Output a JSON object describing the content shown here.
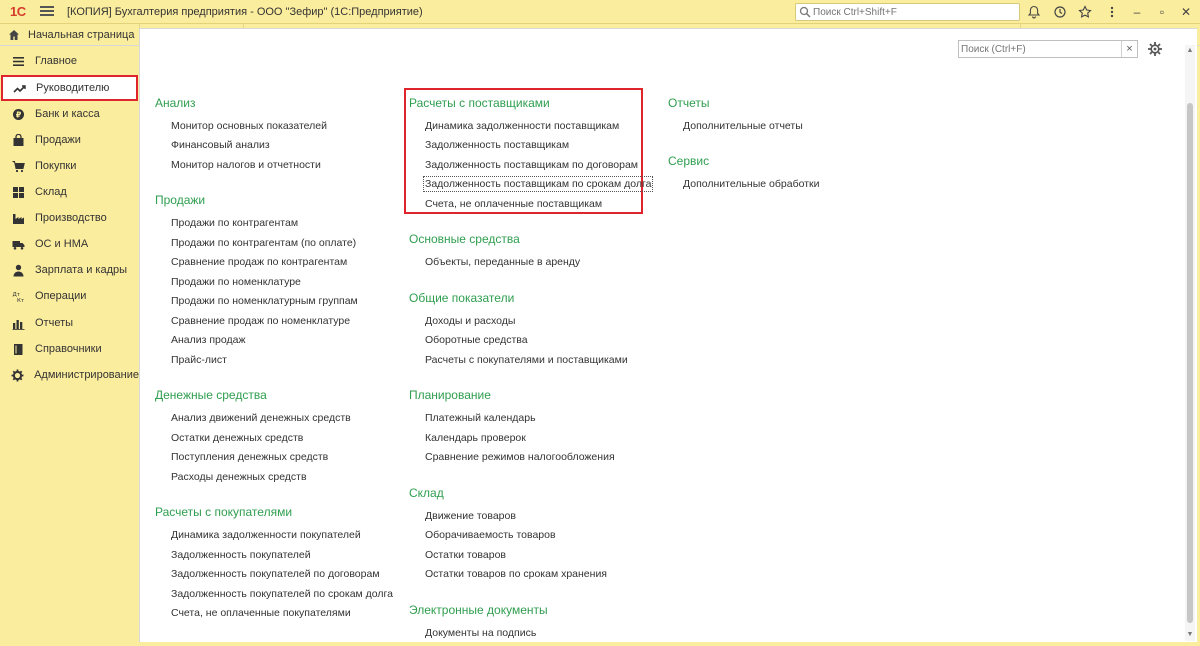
{
  "titlebar": {
    "logo": "1С",
    "title": "[КОПИЯ] Бухгалтерия предприятия - ООО \"Зефир\"  (1С:Предприятие)",
    "search_placeholder": "Поиск Ctrl+Shift+F",
    "icons": [
      "bell-icon",
      "history-icon",
      "star-icon",
      "more-icon"
    ],
    "window_buttons": {
      "minimize": "–",
      "restore": "▫",
      "close": "✕"
    }
  },
  "tabs": {
    "home_label": "Начальная страница"
  },
  "sidebar": {
    "items": [
      {
        "label": "Главное",
        "icon": "list-icon"
      },
      {
        "label": "Руководителю",
        "icon": "trend-icon"
      },
      {
        "label": "Банк и касса",
        "icon": "coin-icon"
      },
      {
        "label": "Продажи",
        "icon": "bag-icon"
      },
      {
        "label": "Покупки",
        "icon": "cart-icon"
      },
      {
        "label": "Склад",
        "icon": "warehouse-icon"
      },
      {
        "label": "Производство",
        "icon": "factory-icon"
      },
      {
        "label": "ОС и НМА",
        "icon": "truck-icon"
      },
      {
        "label": "Зарплата и кадры",
        "icon": "person-icon"
      },
      {
        "label": "Операции",
        "icon": "operations-icon"
      },
      {
        "label": "Отчеты",
        "icon": "bar-chart-icon"
      },
      {
        "label": "Справочники",
        "icon": "book-icon"
      },
      {
        "label": "Администрирование",
        "icon": "gear-icon"
      }
    ],
    "active_index": 1
  },
  "panel": {
    "search_placeholder": "Поиск (Ctrl+F)",
    "clear": "×"
  },
  "columns": {
    "col1": [
      {
        "title": "Анализ",
        "links": [
          "Монитор основных показателей",
          "Финансовый анализ",
          "Монитор налогов и отчетности"
        ]
      },
      {
        "title": "Продажи",
        "links": [
          "Продажи по контрагентам",
          "Продажи по контрагентам (по оплате)",
          "Сравнение продаж по контрагентам",
          "Продажи по номенклатуре",
          "Продажи по номенклатурным группам",
          "Сравнение продаж по номенклатуре",
          "Анализ продаж",
          "Прайс-лист"
        ]
      },
      {
        "title": "Денежные средства",
        "links": [
          "Анализ движений денежных средств",
          "Остатки денежных средств",
          "Поступления денежных средств",
          "Расходы денежных средств"
        ]
      },
      {
        "title": "Расчеты с покупателями",
        "links": [
          "Динамика задолженности покупателей",
          "Задолженность покупателей",
          "Задолженность покупателей по договорам",
          "Задолженность покупателей по срокам долга",
          "Счета, не оплаченные покупателями"
        ]
      }
    ],
    "col2": [
      {
        "title": "Расчеты с поставщиками",
        "links": [
          "Динамика задолженности поставщикам",
          "Задолженность поставщикам",
          "Задолженность поставщикам по договорам",
          "Задолженность поставщикам по срокам долга",
          "Счета, не оплаченные поставщикам"
        ]
      },
      {
        "title": "Основные средства",
        "links": [
          "Объекты, переданные в аренду"
        ]
      },
      {
        "title": "Общие показатели",
        "links": [
          "Доходы и расходы",
          "Оборотные средства",
          "Расчеты с покупателями и поставщиками"
        ]
      },
      {
        "title": "Планирование",
        "links": [
          "Платежный календарь",
          "Календарь проверок",
          "Сравнение режимов налогообложения"
        ]
      },
      {
        "title": "Склад",
        "links": [
          "Движение товаров",
          "Оборачиваемость товаров",
          "Остатки товаров",
          "Остатки товаров по срокам хранения"
        ]
      },
      {
        "title": "Электронные документы",
        "links": [
          "Документы на подпись"
        ]
      }
    ],
    "col3": [
      {
        "title": "Отчеты",
        "links": [
          "Дополнительные отчеты"
        ]
      },
      {
        "title": "Сервис",
        "links": [
          "Дополнительные обработки"
        ]
      }
    ]
  },
  "colors": {
    "background": "#fbed9e",
    "section_title": "#2f9e4f",
    "highlight": "#e0242b"
  }
}
